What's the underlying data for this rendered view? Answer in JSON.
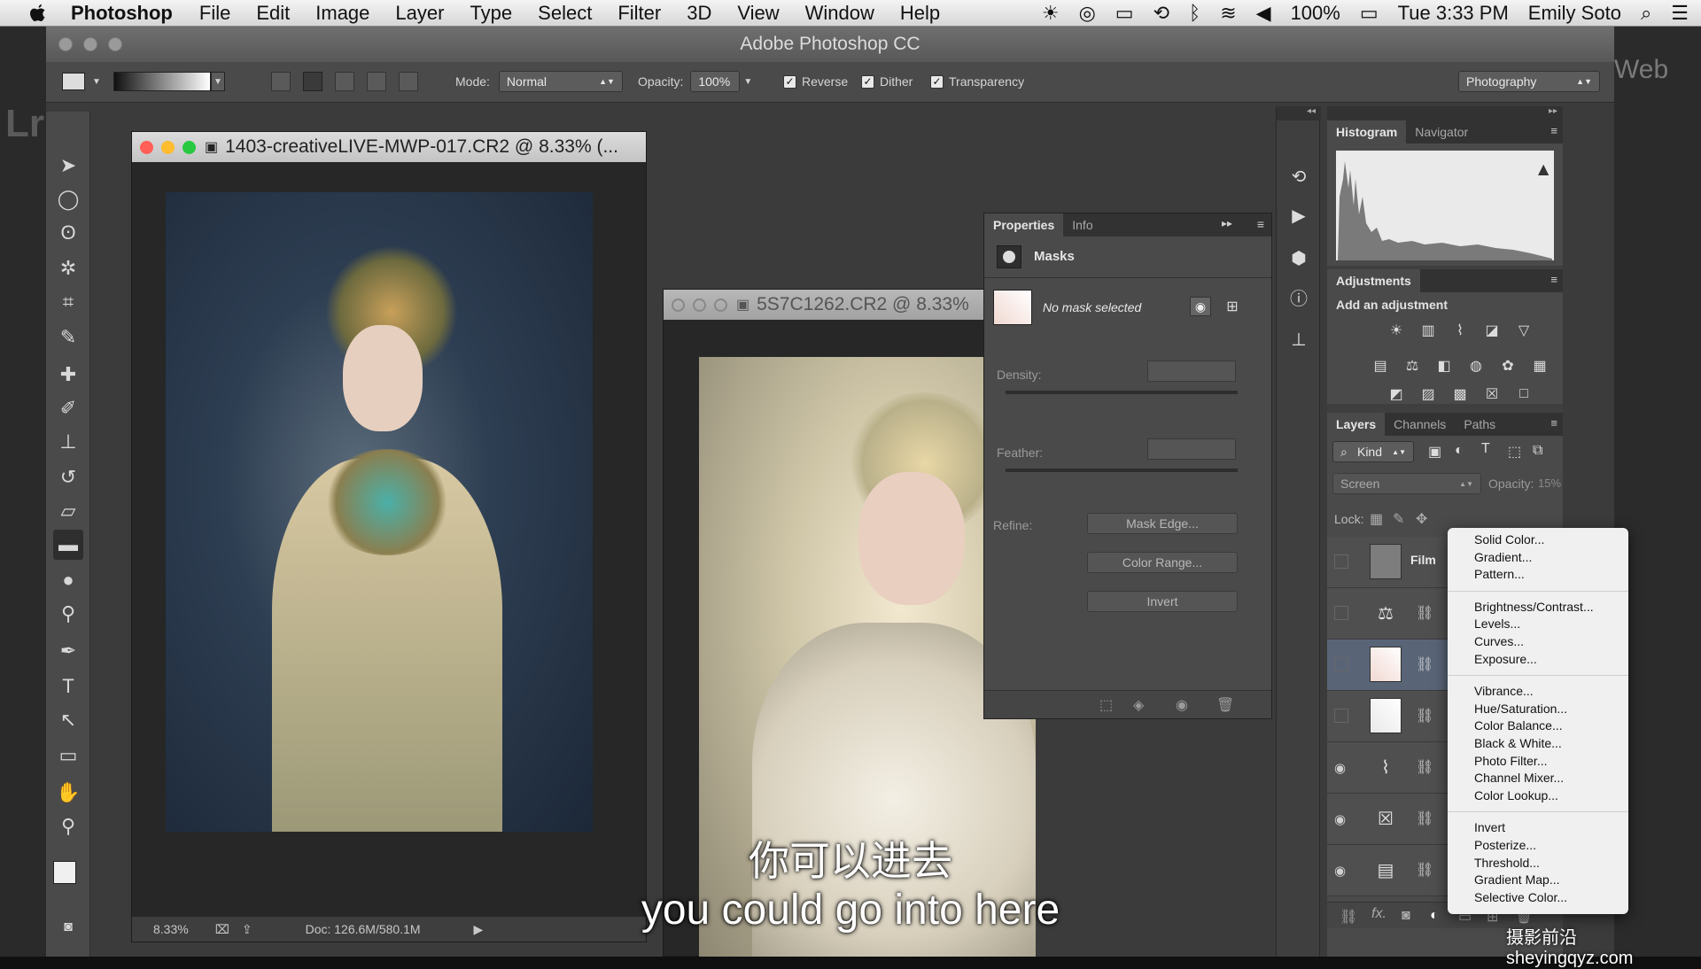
{
  "menubar": {
    "app_name": "Photoshop",
    "items": [
      "File",
      "Edit",
      "Image",
      "Layer",
      "Type",
      "Select",
      "Filter",
      "3D",
      "View",
      "Window",
      "Help"
    ],
    "battery": "100%",
    "clock": "Tue 3:33 PM",
    "user": "Emily Soto"
  },
  "background": {
    "left_text": "Lr",
    "right_text": "Web"
  },
  "window": {
    "title": "Adobe Photoshop CC"
  },
  "options_bar": {
    "mode_label": "Mode:",
    "mode_value": "Normal",
    "opacity_label": "Opacity:",
    "opacity_value": "100%",
    "reverse_label": "Reverse",
    "dither_label": "Dither",
    "transparency_label": "Transparency",
    "workspace": "Photography"
  },
  "documents": [
    {
      "title": "1403-creativeLIVE-MWP-017.CR2 @ 8.33% (...",
      "zoom": "8.33%",
      "doc_info": "Doc: 126.6M/580.1M"
    },
    {
      "title": "5S7C1262.CR2 @ 8.33%"
    }
  ],
  "properties_panel": {
    "tabs": [
      "Properties",
      "Info"
    ],
    "section_title": "Masks",
    "mask_status": "No mask selected",
    "density_label": "Density:",
    "feather_label": "Feather:",
    "refine_label": "Refine:",
    "mask_edge_button": "Mask Edge...",
    "color_range_button": "Color Range...",
    "invert_button": "Invert"
  },
  "histogram_panel": {
    "tabs": [
      "Histogram",
      "Navigator"
    ]
  },
  "adjustments_panel": {
    "tab": "Adjustments",
    "heading": "Add an adjustment"
  },
  "layers_panel": {
    "tabs": [
      "Layers",
      "Channels",
      "Paths"
    ],
    "filter_kind": "Kind",
    "blend_mode": "Screen",
    "opacity_label": "Opacity:",
    "opacity_value": "15%",
    "lock_label": "Lock:",
    "top_layer_name": "Film"
  },
  "context_menu": {
    "groups": [
      [
        "Solid Color...",
        "Gradient...",
        "Pattern..."
      ],
      [
        "Brightness/Contrast...",
        "Levels...",
        "Curves...",
        "Exposure..."
      ],
      [
        "Vibrance...",
        "Hue/Saturation...",
        "Color Balance...",
        "Black & White...",
        "Photo Filter...",
        "Channel Mixer...",
        "Color Lookup..."
      ],
      [
        "Invert",
        "Posterize...",
        "Threshold...",
        "Gradient Map...",
        "Selective Color..."
      ]
    ]
  },
  "subtitles": {
    "chinese": "你可以进去",
    "english": "you could go into here"
  },
  "watermark": "摄影前沿sheyingqyz.com",
  "colors": {
    "accent_red": "#ff5f57",
    "accent_yellow": "#febc2e",
    "accent_green": "#28c840",
    "panel_bg": "#4a4a4a",
    "app_bg": "#3b3b3b"
  }
}
